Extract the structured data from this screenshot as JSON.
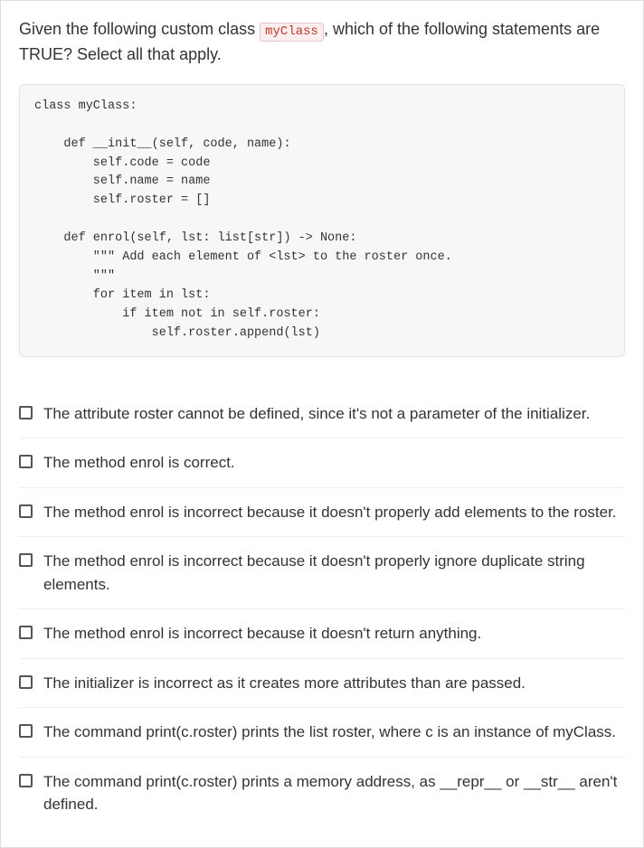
{
  "question": {
    "pre_text": "Given the following custom class ",
    "code_token": "myClass",
    "post_text": ", which of the following statements are TRUE? Select all that apply."
  },
  "code_block": "class myClass:\n\n    def __init__(self, code, name):\n        self.code = code\n        self.name = name\n        self.roster = []\n\n    def enrol(self, lst: list[str]) -> None:\n        \"\"\" Add each element of <lst> to the roster once.\n        \"\"\"\n        for item in lst:\n            if item not in self.roster:\n                self.roster.append(lst)",
  "options": [
    {
      "text": "The attribute roster cannot be defined, since it's not a parameter of the initializer."
    },
    {
      "text": "The method enrol is correct."
    },
    {
      "text": "The method enrol is incorrect because it doesn't properly add elements to the roster."
    },
    {
      "text": "The method enrol is incorrect because it doesn't properly ignore duplicate string elements."
    },
    {
      "text": "The method enrol is incorrect because it doesn't return anything."
    },
    {
      "text": "The initializer is incorrect as it creates more attributes than are passed."
    },
    {
      "text": "The command print(c.roster) prints the list roster, where c is an instance of myClass."
    },
    {
      "text": "The command print(c.roster) prints a memory address, as __repr__ or __str__ aren't defined."
    }
  ]
}
